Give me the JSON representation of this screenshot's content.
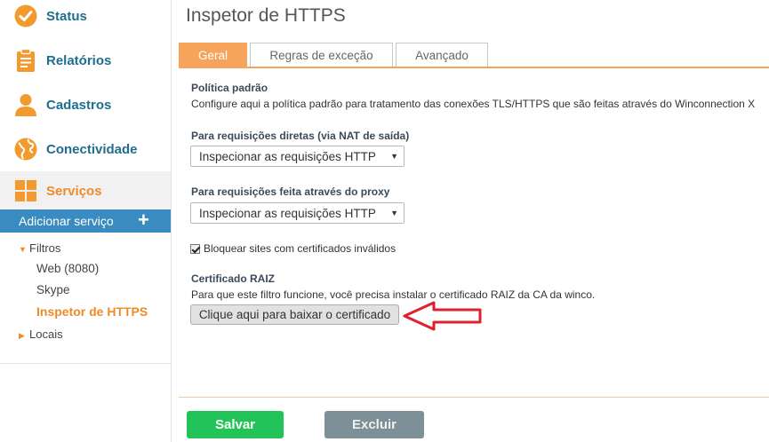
{
  "sidebar": {
    "items": [
      {
        "label": "Status",
        "icon": "check-circle-icon"
      },
      {
        "label": "Relatórios",
        "icon": "clipboard-icon"
      },
      {
        "label": "Cadastros",
        "icon": "user-icon"
      },
      {
        "label": "Conectividade",
        "icon": "globe-icon"
      },
      {
        "label": "Serviços",
        "icon": "grid-icon"
      }
    ],
    "add_service_label": "Adicionar serviço",
    "add_service_plus": "+",
    "tree": {
      "filtros_label": "Filtros",
      "sub_items": [
        "Web (8080)",
        "Skype",
        "Inspetor de HTTPS"
      ],
      "locais_label": "Locais"
    }
  },
  "main": {
    "title": "Inspetor de HTTPS",
    "tabs": [
      {
        "label": "Geral",
        "active": true
      },
      {
        "label": "Regras de exceção",
        "active": false
      },
      {
        "label": "Avançado",
        "active": false
      }
    ],
    "default_policy": {
      "title": "Política padrão",
      "description": "Configure aqui a política padrão para tratamento das conexões TLS/HTTPS que são feitas através do Winconnection X"
    },
    "direct_requests": {
      "label": "Para requisições diretas (via NAT de saída)",
      "selected": "Inspecionar as requisições HTTP"
    },
    "proxy_requests": {
      "label": "Para requisições feita através do proxy",
      "selected": "Inspecionar as requisições HTTP"
    },
    "block_invalid_certs": {
      "label": "Bloquear sites com certificados inválidos",
      "checked": true
    },
    "root_cert": {
      "title": "Certificado RAIZ",
      "description": "Para que este filtro funcione, você precisa instalar o certificado RAIZ da CA da winco.",
      "download_label": "Clique aqui para baixar o certificado"
    }
  },
  "footer": {
    "save_label": "Salvar",
    "delete_label": "Excluir"
  },
  "colors": {
    "accent_orange": "#ef8a2a",
    "nav_blue": "#1f6e8f",
    "save_green": "#22c45a",
    "delete_gray": "#7d8f97",
    "annotation_red": "#e0202a"
  }
}
